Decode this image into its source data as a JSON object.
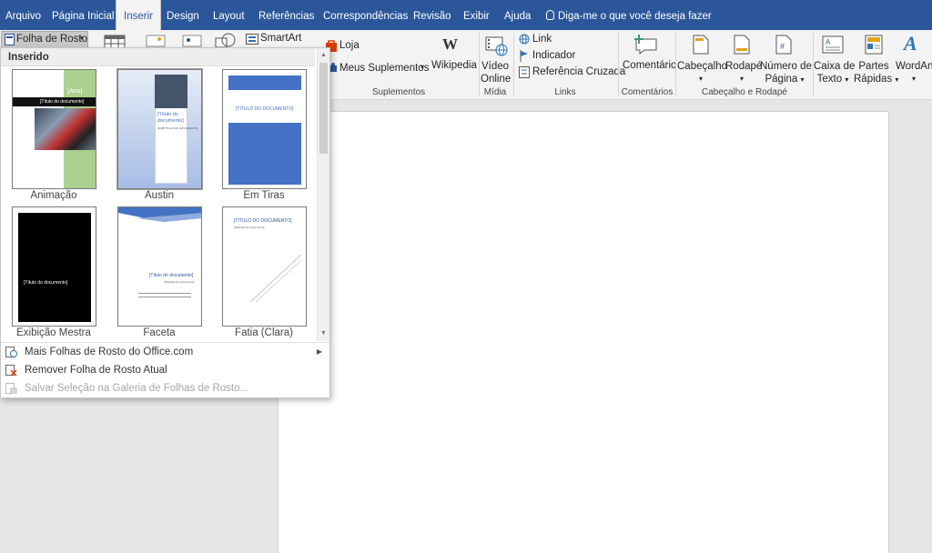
{
  "tabs": [
    "Arquivo",
    "Página Inicial",
    "Inserir",
    "Design",
    "Layout",
    "Referências",
    "Correspondências",
    "Revisão",
    "Exibir",
    "Ajuda"
  ],
  "active_tab": "Inserir",
  "tell_me": "Diga-me o que você deseja fazer",
  "ribbon": {
    "cover_button": "Folha de Rosto",
    "smartart": "SmartArt",
    "store": "Loja",
    "my_addins": "Meus Suplementos",
    "wikipedia": "Wikipedia",
    "group_addins": "Suplementos",
    "video_line1": "Vídeo",
    "video_line2": "Online",
    "group_media": "Mídia",
    "link": "Link",
    "bookmark": "Indicador",
    "cross_ref": "Referência Cruzada",
    "group_links": "Links",
    "comment": "Comentário",
    "group_comments": "Comentários",
    "header": "Cabeçalho",
    "footer": "Rodapé",
    "page_number_line1": "Número de",
    "page_number_line2": "Página",
    "group_header_footer": "Cabeçalho e Rodapé",
    "textbox_line1": "Caixa de",
    "textbox_line2": "Texto",
    "quickparts_line1": "Partes",
    "quickparts_line2": "Rápidas",
    "wordart": "WordArt"
  },
  "gallery": {
    "heading": "Inserido",
    "items": [
      {
        "label": "Animação",
        "text_a": "[Ano]",
        "text_b": "[Título do documento]"
      },
      {
        "label": "Austin",
        "text_a": "[Título do documento]",
        "text_b": "[SUBTÍTULO DO DOCUMENTO]"
      },
      {
        "label": "Em Tiras",
        "text_a": "[TÍTULO DO DOCUMENTO]",
        "text_b": ""
      },
      {
        "label": "Exibição Mestra",
        "text_a": "[Título do documento]",
        "text_b": ""
      },
      {
        "label": "Faceta",
        "text_a": "[Título do documento]",
        "text_b": "[Subtítulo do documento]"
      },
      {
        "label": "Fatia (Clara)",
        "text_a": "[TÍTULO DO DOCUMENTO]",
        "text_b": "[Subtítulo do documento]"
      }
    ]
  },
  "menu": {
    "more_covers": "Mais Folhas de Rosto do Office.com",
    "remove_cover": "Remover Folha de Rosto Atual",
    "save_selection": "Salvar Seleção na Galeria de Folhas de Rosto..."
  },
  "colors": {
    "accent": "#2b579a",
    "ribbon_bg": "#f3f3f3",
    "green": "#a9d08e",
    "blue": "#4472c4"
  }
}
